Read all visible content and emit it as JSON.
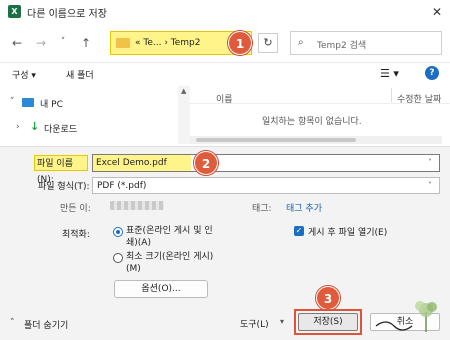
{
  "window": {
    "title": "다른 이름으로 저장",
    "app_icon": "X",
    "close_glyph": "✕"
  },
  "nav": {
    "back": "←",
    "forward": "→",
    "recent": "˅",
    "up": "↑",
    "address_crumb": "« Te... › Temp2",
    "refresh": "↻",
    "search_icon": "⌕",
    "search_placeholder": "Temp2 검색"
  },
  "badges": {
    "one": "1",
    "two": "2",
    "three": "3"
  },
  "toolbar": {
    "organize": "구성 ▾",
    "new_folder": "새 폴더",
    "view": "☰ ▾",
    "help": "?"
  },
  "tree": {
    "this_pc_chevron": "˅",
    "this_pc": "내 PC",
    "downloads_chevron": "›",
    "downloads_icon": "↓",
    "downloads": "다운로드",
    "scroll_up": "▲"
  },
  "files": {
    "columns": [
      "이름",
      "수정한 날짜"
    ],
    "empty_message": "일치하는 항목이 없습니다."
  },
  "form": {
    "file_name_label": "파일 이름(N):",
    "file_name_value": "Excel Demo.pdf",
    "dropdown_arrow": "˅",
    "file_type_label": "파일 형식(T):",
    "file_type_value": "PDF (*.pdf)",
    "author_label": "만든 이:",
    "tags_label": "태그:",
    "tags_link": "태그 추가",
    "optimize_label": "최적화:",
    "optimize_standard": "표준(온라인 게시 및 인쇄)(A)",
    "optimize_minimum": "최소 크기(온라인 게시)(M)",
    "open_after_publish": "게시 후 파일 열기(E)",
    "checkmark": "✓",
    "options_button": "옵션(O)..."
  },
  "footer": {
    "hide_folders_chevron": "˄",
    "hide_folders": "폴더 숨기기",
    "tools": "도구(L)",
    "tools_arrow": "▾",
    "save": "저장(S)",
    "cancel": "취소"
  },
  "colors": {
    "highlight": "#fff48a",
    "badge": "#e05a3c",
    "accent": "#1b6ec2"
  }
}
